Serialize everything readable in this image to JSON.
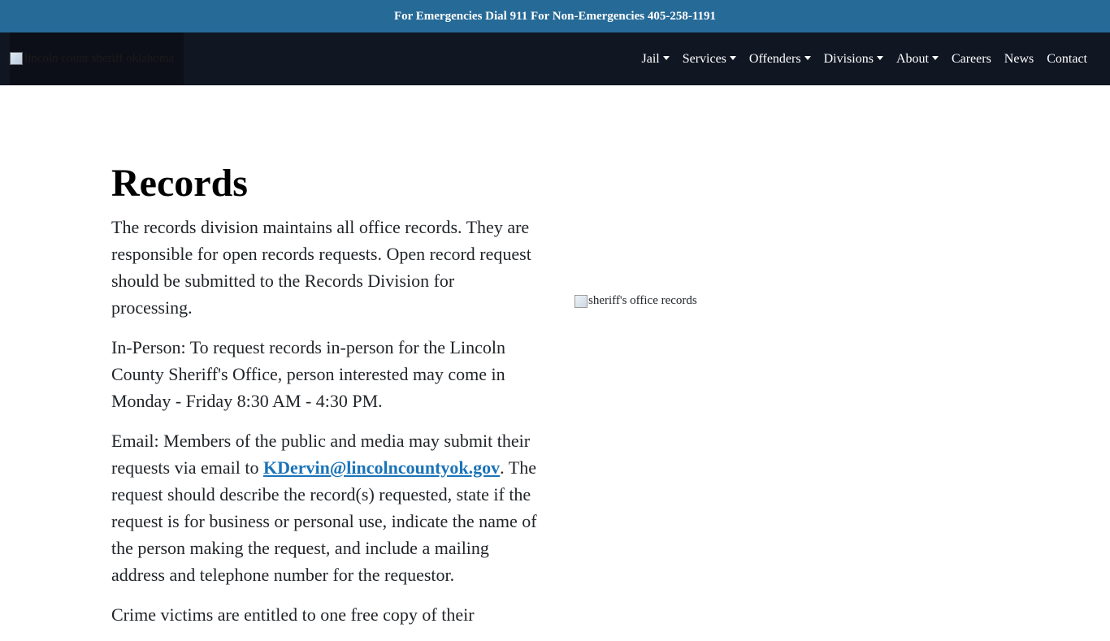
{
  "topbar": {
    "text": "For Emergencies Dial 911 For Non-Emergencies 405-258-1191"
  },
  "header": {
    "logo_alt": "lincoln count sheriff oklahoma",
    "nav": [
      {
        "label": "Jail",
        "dropdown": true
      },
      {
        "label": "Services",
        "dropdown": true
      },
      {
        "label": "Offenders",
        "dropdown": true
      },
      {
        "label": "Divisions",
        "dropdown": true
      },
      {
        "label": "About",
        "dropdown": true
      },
      {
        "label": "Careers",
        "dropdown": false
      },
      {
        "label": "News",
        "dropdown": false
      },
      {
        "label": "Contact",
        "dropdown": false
      }
    ]
  },
  "main": {
    "title": "Records",
    "paragraph1": "The records division maintains all office records. They are responsible for open records requests. Open record request should be submitted to the Records Division for processing.",
    "paragraph2": "In-Person: To request records in-person for the Lincoln County Sheriff's Office, person interested may come in Monday - Friday 8:30 AM - 4:30 PM.",
    "paragraph3_before": "Email: Members of the public and media may submit their requests via email to ",
    "email": "KDervin@lincolncountyok.gov",
    "paragraph3_after": ". The request should describe the record(s) requested, state if the request is for business or personal use, indicate the name of the person making the request, and include a mailing address and telephone number for the requestor.",
    "paragraph4": "Crime victims are entitled to one free copy of their",
    "image_alt": "sheriff's office records"
  },
  "colors": {
    "topbar_bg": "#266a97",
    "navbar_bg": "#101622",
    "link": "#1a73b8"
  }
}
